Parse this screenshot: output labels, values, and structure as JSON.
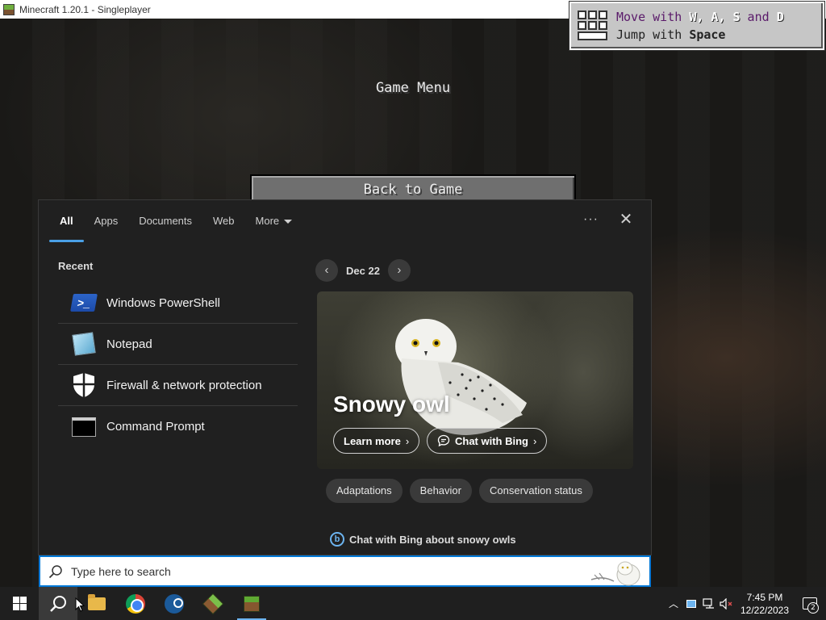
{
  "window": {
    "title": "Minecraft 1.20.1 - Singleplayer",
    "minimize": "—",
    "restore": "❐",
    "close": "✕"
  },
  "game": {
    "menu_title": "Game Menu",
    "back_button": "Back to Game",
    "tutorial": {
      "line1_prefix": "Move with ",
      "line1_keys": "W, A, S",
      "line1_and": " and ",
      "line1_key_last": "D",
      "line2_prefix": "Jump with ",
      "line2_key": "Space"
    }
  },
  "search": {
    "tabs": [
      {
        "label": "All",
        "active": true
      },
      {
        "label": "Apps"
      },
      {
        "label": "Documents"
      },
      {
        "label": "Web"
      },
      {
        "label": "More"
      }
    ],
    "more_options": "···",
    "close": "✕",
    "recent_title": "Recent",
    "recent": [
      {
        "label": "Windows PowerShell",
        "icon": "powershell-icon"
      },
      {
        "label": "Notepad",
        "icon": "notepad-icon"
      },
      {
        "label": "Firewall & network protection",
        "icon": "shield-icon"
      },
      {
        "label": "Command Prompt",
        "icon": "command-prompt-icon"
      }
    ],
    "date": "Dec 22",
    "prev": "‹",
    "next": "›",
    "hero": {
      "title": "Snowy owl",
      "learn_more": "Learn more",
      "chat_bing": "Chat with Bing",
      "chev": "›"
    },
    "chips": [
      "Adaptations",
      "Behavior",
      "Conservation status"
    ],
    "bing_chat": "Chat with Bing about snowy owls",
    "bing_letter": "b",
    "placeholder": "Type here to search"
  },
  "taskbar": {
    "time": "7:45 PM",
    "date": "12/22/2023",
    "notification_count": "2",
    "tray_chevron": "︿"
  },
  "colors": {
    "accent": "#0078d7",
    "panel_bg": "#202020",
    "taskbar_bg": "#1f1f1f"
  }
}
